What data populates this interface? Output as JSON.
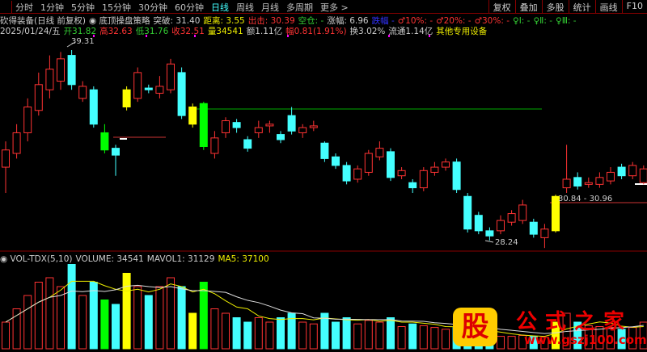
{
  "tabs": [
    "分时",
    "1分钟",
    "5分钟",
    "15分钟",
    "30分钟",
    "60分钟",
    "日线",
    "周线",
    "月线",
    "多周期",
    "更多 >"
  ],
  "active_tab": "日线",
  "right_buttons": [
    "复权",
    "叠加",
    "多股",
    "统计",
    "画线",
    "F10"
  ],
  "info1": [
    {
      "t": "砍得装备(日线 前复权)",
      "c": "#ccc"
    },
    {
      "t": "◉ 底顶操盘策略",
      "c": "#ccc"
    },
    {
      "t": "突破: 31.40",
      "c": "#ccc"
    },
    {
      "t": "距离: 3.55",
      "c": "#ee0"
    },
    {
      "t": "出击: 30.39",
      "c": "#f33"
    },
    {
      "t": "空仓: -",
      "c": "#3c3"
    },
    {
      "t": "涨幅: 6.96",
      "c": "#ccc"
    },
    {
      "t": "跌幅 -",
      "c": "#33f"
    },
    {
      "t": "♂10%: -",
      "c": "#f33"
    },
    {
      "t": "♂20%: -",
      "c": "#f33"
    },
    {
      "t": "♂30%: -",
      "c": "#f33"
    },
    {
      "t": "♀Ⅰ: -",
      "c": "#3c3"
    },
    {
      "t": "♀Ⅱ: -",
      "c": "#3c3"
    },
    {
      "t": "♀Ⅲ: -",
      "c": "#3c3"
    }
  ],
  "info2": [
    {
      "t": "2025/01/24/五",
      "c": "#ccc"
    },
    {
      "t": "开31.82",
      "c": "#3c3"
    },
    {
      "t": "高32.63",
      "c": "#f33"
    },
    {
      "t": "低31.76",
      "c": "#3c3"
    },
    {
      "t": "收32.51",
      "c": "#f33"
    },
    {
      "t": "量34541",
      "c": "#ee0"
    },
    {
      "t": "额1.11亿",
      "c": "#ccc"
    },
    {
      "t": "幅0.81(1.91%)",
      "c": "#f33"
    },
    {
      "t": "换3.02%",
      "c": "#ccc"
    },
    {
      "t": "流通1.14亿",
      "c": "#ccc"
    },
    {
      "t": "其他专用设备",
      "c": "#ee0"
    }
  ],
  "labels": {
    "high": "39.31",
    "low": "28.24",
    "range": "30.84 - 30.96"
  },
  "vol_header": [
    {
      "t": "◉ VOL-TDX(5,10)",
      "c": "#ccc"
    },
    {
      "t": "VOLUME: 34541",
      "c": "#ccc"
    },
    {
      "t": "MAVOL1: 31129",
      "c": "#ccc"
    },
    {
      "t": "MA5: 37100",
      "c": "#ee0"
    }
  ],
  "logo": {
    "badge": "股",
    "name": "公式之家",
    "url": "www.gszj100.com"
  },
  "colors": {
    "up": "#f33",
    "down": "#4ff",
    "yellow": "#ff0",
    "green": "#0f0"
  },
  "candles": [
    [
      32.5,
      33.5,
      34,
      31,
      "u",
      30
    ],
    [
      33.3,
      34.5,
      35,
      33,
      "u",
      45
    ],
    [
      34.5,
      36,
      36.5,
      34,
      "u",
      60
    ],
    [
      35.8,
      37.3,
      38,
      35.5,
      "u",
      75
    ],
    [
      37,
      38.2,
      39,
      36.5,
      "u",
      80
    ],
    [
      37.5,
      38.8,
      39.2,
      37,
      "u",
      70
    ],
    [
      39,
      37.3,
      39.31,
      37,
      "d",
      95
    ],
    [
      36.5,
      37.2,
      37.5,
      36.3,
      "u",
      60
    ],
    [
      37,
      35,
      37.2,
      34.8,
      "d",
      75
    ],
    [
      34.5,
      33.5,
      35,
      33.3,
      "g",
      55
    ],
    [
      33.6,
      33.2,
      33.8,
      32,
      "d",
      50
    ],
    [
      36,
      37,
      37.2,
      35.8,
      "y",
      85
    ],
    [
      36.5,
      38,
      38.3,
      36.3,
      "u",
      70
    ],
    [
      37.1,
      37,
      37.3,
      36.8,
      "d",
      60
    ],
    [
      36.8,
      37.2,
      37.8,
      36.5,
      "u",
      70
    ],
    [
      37,
      38.5,
      38.8,
      36.8,
      "u",
      80
    ],
    [
      38,
      35.5,
      38.3,
      35.3,
      "d",
      70
    ],
    [
      36,
      35,
      36.2,
      34.8,
      "y",
      40
    ],
    [
      36.2,
      33.7,
      36.3,
      33.5,
      "g",
      75
    ],
    [
      33.3,
      34.2,
      34.6,
      33,
      "u",
      45
    ],
    [
      34.5,
      35.2,
      35.4,
      34.2,
      "u",
      40
    ],
    [
      35.1,
      34.8,
      35.3,
      34.5,
      "d",
      35
    ],
    [
      34.1,
      33.6,
      34.3,
      33.4,
      "d",
      30
    ],
    [
      34.5,
      34.8,
      35.2,
      34.2,
      "u",
      35
    ],
    [
      34.9,
      35,
      35.2,
      34.5,
      "u",
      30
    ],
    [
      34.4,
      34.1,
      34.6,
      33.9,
      "d",
      35
    ],
    [
      35.5,
      34.6,
      36,
      34.4,
      "d",
      40
    ],
    [
      34.5,
      34.8,
      35,
      34.2,
      "u",
      30
    ],
    [
      34.8,
      34.9,
      35.2,
      34.6,
      "u",
      28
    ],
    [
      33.9,
      33,
      34,
      32.8,
      "d",
      40
    ],
    [
      33.1,
      32.6,
      33.3,
      32.4,
      "d",
      30
    ],
    [
      32.6,
      31.7,
      32.8,
      31.5,
      "d",
      35
    ],
    [
      31.8,
      32.4,
      32.6,
      31.6,
      "u",
      28
    ],
    [
      32.2,
      33.3,
      33.5,
      32,
      "u",
      32
    ],
    [
      33.1,
      33.6,
      34,
      32.9,
      "u",
      30
    ],
    [
      33.4,
      31.9,
      33.6,
      31.7,
      "d",
      35
    ],
    [
      32,
      32.3,
      32.5,
      31.8,
      "u",
      25
    ],
    [
      31.6,
      31.3,
      31.8,
      31,
      "d",
      28
    ],
    [
      31.3,
      32.3,
      32.5,
      31.1,
      "u",
      26
    ],
    [
      32.2,
      32.5,
      32.8,
      32,
      "u",
      24
    ],
    [
      32.5,
      32.8,
      33,
      32.3,
      "u",
      22
    ],
    [
      32.8,
      31.2,
      33,
      31,
      "d",
      24
    ],
    [
      30.8,
      28.9,
      31,
      28.7,
      "d",
      22
    ],
    [
      29.7,
      28.8,
      29.9,
      28.6,
      "d",
      18
    ],
    [
      28.8,
      28.5,
      29,
      28.24,
      "d",
      16
    ],
    [
      28.8,
      29.4,
      29.7,
      28.6,
      "u",
      14
    ],
    [
      29.3,
      29.8,
      30,
      29.1,
      "u",
      14
    ],
    [
      29.4,
      30.3,
      30.6,
      29.2,
      "u",
      15
    ],
    [
      29.3,
      28.6,
      29.5,
      28.4,
      "d",
      14
    ],
    [
      28.4,
      28.9,
      29.2,
      27.8,
      "u",
      13
    ],
    [
      28.8,
      30.8,
      30.9,
      28.7,
      "y",
      30
    ],
    [
      31.3,
      31.8,
      33.8,
      31,
      "u",
      40
    ],
    [
      31.9,
      31.4,
      32.2,
      31.2,
      "d",
      30
    ],
    [
      31.5,
      31.6,
      31.9,
      31.3,
      "u",
      26
    ],
    [
      31.5,
      31.9,
      32.2,
      31.3,
      "u",
      25
    ],
    [
      31.7,
      32.2,
      32.5,
      31.5,
      "u",
      24
    ],
    [
      32.5,
      32,
      32.7,
      31.8,
      "d",
      22
    ],
    [
      32,
      32.6,
      32.8,
      31.8,
      "u",
      24
    ],
    [
      31.6,
      32.4,
      32.6,
      31.5,
      "u",
      30
    ]
  ]
}
